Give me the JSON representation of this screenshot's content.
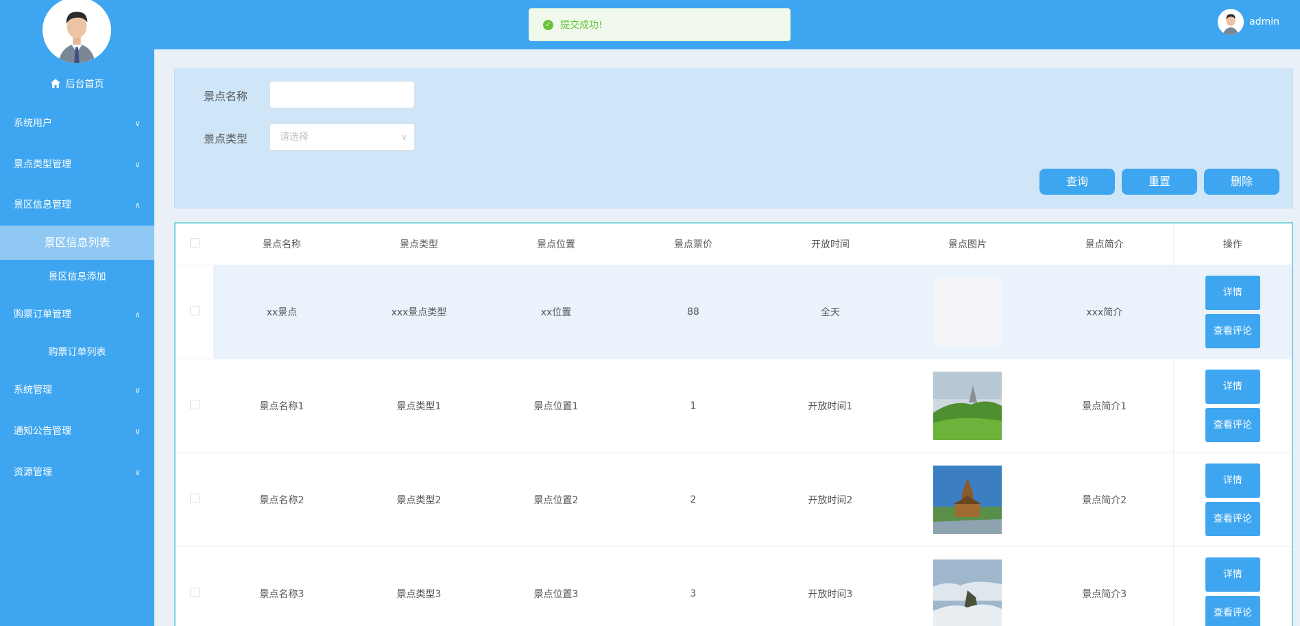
{
  "sidebar": {
    "home": "后台首页",
    "menus": [
      {
        "label": "系统用户"
      },
      {
        "label": "景点类型管理"
      },
      {
        "label": "景区信息管理"
      },
      {
        "label": "购票订单管理"
      },
      {
        "label": "系统管理"
      },
      {
        "label": "通知公告管理"
      },
      {
        "label": "资源管理"
      }
    ],
    "sub": [
      {
        "label": "景区信息列表"
      },
      {
        "label": "景区信息添加"
      },
      {
        "label": "购票订单列表"
      }
    ]
  },
  "header": {
    "username": "admin"
  },
  "toast": {
    "message": "提交成功!"
  },
  "search": {
    "name_label": "景点名称",
    "name_value": "",
    "type_label": "景点类型",
    "type_placeholder": "请选择",
    "query_btn": "查询",
    "reset_btn": "重置",
    "delete_btn": "删除"
  },
  "table": {
    "headers": [
      "景点名称",
      "景点类型",
      "景点位置",
      "景点票价",
      "开放时间",
      "景点图片",
      "景点简介",
      "操作"
    ],
    "detail_btn": "详情",
    "comment_btn": "查看评论",
    "rows": [
      {
        "name": "xx景点",
        "type": "xxx景点类型",
        "location": "xx位置",
        "price": "88",
        "time": "全天",
        "image": "blank",
        "intro": "xxx简介"
      },
      {
        "name": "景点名称1",
        "type": "景点类型1",
        "location": "景点位置1",
        "price": "1",
        "time": "开放时间1",
        "image": "mountain-meadow",
        "intro": "景点简介1"
      },
      {
        "name": "景点名称2",
        "type": "景点类型2",
        "location": "景点位置2",
        "price": "2",
        "time": "开放时间2",
        "image": "wooden-church",
        "intro": "景点简介2"
      },
      {
        "name": "景点名称3",
        "type": "景点类型3",
        "location": "景点位置3",
        "price": "3",
        "time": "开放时间3",
        "image": "cliff-clouds",
        "intro": "景点简介3"
      }
    ]
  }
}
